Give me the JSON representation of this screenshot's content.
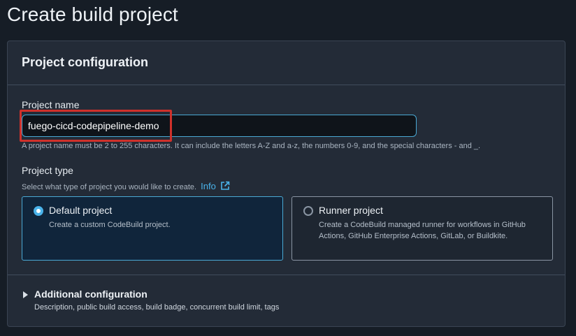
{
  "page": {
    "title": "Create build project"
  },
  "panel": {
    "title": "Project configuration"
  },
  "project_name": {
    "label": "Project name",
    "value": "fuego-cicd-codepipeline-demo",
    "hint": "A project name must be 2 to 255 characters. It can include the letters A-Z and a-z, the numbers 0-9, and the special characters - and _."
  },
  "project_type": {
    "label": "Project type",
    "description": "Select what type of project you would like to create.",
    "info_link": "Info",
    "options": [
      {
        "title": "Default project",
        "description": "Create a custom CodeBuild project.",
        "selected": true
      },
      {
        "title": "Runner project",
        "description": "Create a CodeBuild managed runner for workflows in GitHub Actions, GitHub Enterprise Actions, GitLab, or Buildkite.",
        "selected": false
      }
    ]
  },
  "additional": {
    "title": "Additional configuration",
    "description": "Description, public build access, build badge, concurrent build limit, tags"
  },
  "colors": {
    "accent": "#4ab3ea",
    "highlight": "#d0312b",
    "background": "#161d26",
    "panel": "#232b37"
  }
}
